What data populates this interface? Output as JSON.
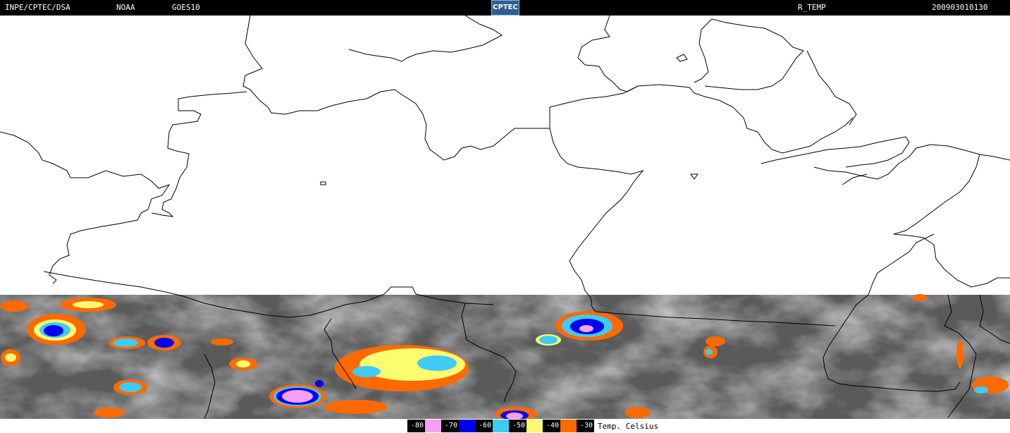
{
  "header": {
    "source": "INPE/CPTEC/DSA",
    "agency": "NOAA",
    "satellite": "GOES10",
    "logo_text": "CPTEC",
    "product": "R_TEMP",
    "datetime": "200903010130"
  },
  "legend": {
    "items": [
      {
        "label": "-80",
        "color": "#f79ff3"
      },
      {
        "label": "-70",
        "color": "#0000f0"
      },
      {
        "label": "-60",
        "color": "#3fcbf4"
      },
      {
        "label": "-50",
        "color": "#fcfc70"
      },
      {
        "label": "-40",
        "color": "#ff6a00"
      },
      {
        "label": "-30",
        "color": "#000000"
      }
    ],
    "unit": "Temp. Celsius"
  },
  "colors": {
    "ir_background": "#5a5a5a",
    "borders": "#000000"
  }
}
